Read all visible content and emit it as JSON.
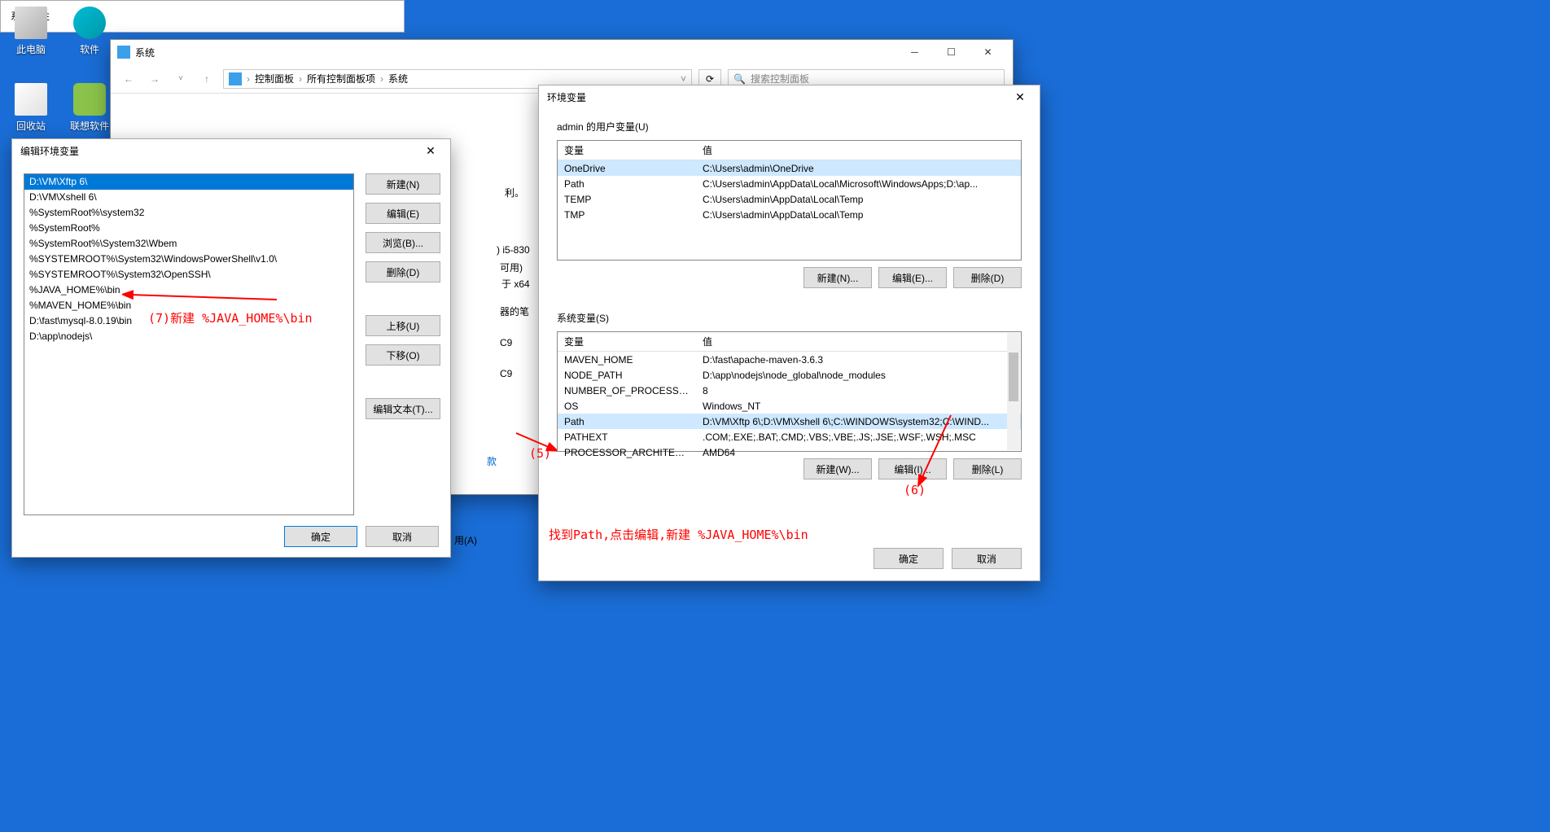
{
  "desktop": {
    "icons": [
      {
        "label": "此电脑"
      },
      {
        "label": "软件"
      },
      {
        "label": "回收站"
      },
      {
        "label": "联想软件"
      }
    ]
  },
  "system_window": {
    "title": "系统",
    "breadcrumb": [
      "控制面板",
      "所有控制面板项",
      "系统"
    ],
    "search_placeholder": "搜索控制面板"
  },
  "props_window": {
    "title": "系统属性"
  },
  "edit_env": {
    "title": "编辑环境变量",
    "items": [
      "D:\\VM\\Xftp 6\\",
      "D:\\VM\\Xshell 6\\",
      "%SystemRoot%\\system32",
      "%SystemRoot%",
      "%SystemRoot%\\System32\\Wbem",
      "%SYSTEMROOT%\\System32\\WindowsPowerShell\\v1.0\\",
      "%SYSTEMROOT%\\System32\\OpenSSH\\",
      "%JAVA_HOME%\\bin",
      "%MAVEN_HOME%\\bin",
      "D:\\fast\\mysql-8.0.19\\bin",
      "D:\\app\\nodejs\\"
    ],
    "buttons": {
      "new": "新建(N)",
      "edit": "编辑(E)",
      "browse": "浏览(B)...",
      "delete": "删除(D)",
      "up": "上移(U)",
      "down": "下移(O)",
      "edit_text": "编辑文本(T)..."
    },
    "ok": "确定",
    "cancel": "取消"
  },
  "env_window": {
    "title": "环境变量",
    "user_section": "admin 的用户变量(U)",
    "system_section": "系统变量(S)",
    "col_var": "变量",
    "col_val": "值",
    "user_vars": [
      {
        "name": "OneDrive",
        "value": "C:\\Users\\admin\\OneDrive"
      },
      {
        "name": "Path",
        "value": "C:\\Users\\admin\\AppData\\Local\\Microsoft\\WindowsApps;D:\\ap..."
      },
      {
        "name": "TEMP",
        "value": "C:\\Users\\admin\\AppData\\Local\\Temp"
      },
      {
        "name": "TMP",
        "value": "C:\\Users\\admin\\AppData\\Local\\Temp"
      }
    ],
    "system_vars": [
      {
        "name": "MAVEN_HOME",
        "value": "D:\\fast\\apache-maven-3.6.3"
      },
      {
        "name": "NODE_PATH",
        "value": "D:\\app\\nodejs\\node_global\\node_modules"
      },
      {
        "name": "NUMBER_OF_PROCESSORS",
        "value": "8"
      },
      {
        "name": "OS",
        "value": "Windows_NT"
      },
      {
        "name": "Path",
        "value": "D:\\VM\\Xftp 6\\;D:\\VM\\Xshell 6\\;C:\\WINDOWS\\system32;C:\\WIND..."
      },
      {
        "name": "PATHEXT",
        "value": ".COM;.EXE;.BAT;.CMD;.VBS;.VBE;.JS;.JSE;.WSF;.WSH;.MSC"
      },
      {
        "name": "PROCESSOR_ARCHITECTURE",
        "value": "AMD64"
      }
    ],
    "buttons": {
      "user_new": "新建(N)...",
      "user_edit": "编辑(E)...",
      "user_delete": "删除(D)",
      "sys_new": "新建(W)...",
      "sys_edit": "编辑(I)...",
      "sys_delete": "删除(L)"
    },
    "ok": "确定",
    "cancel": "取消"
  },
  "partial": {
    "p1": "利。",
    "p2": ") i5-830",
    "p3": "可用)",
    "p4": "于 x64",
    "p5": "器的笔",
    "p6": "C9",
    "p7": "C9",
    "p8": "款",
    "p9": "用(A)"
  },
  "annotations": {
    "a5": "(5)",
    "a6": "(6)",
    "a7": "(7)新建 %JAVA_HOME%\\bin",
    "a_bottom": "找到Path,点击编辑,新建 %JAVA_HOME%\\bin"
  }
}
